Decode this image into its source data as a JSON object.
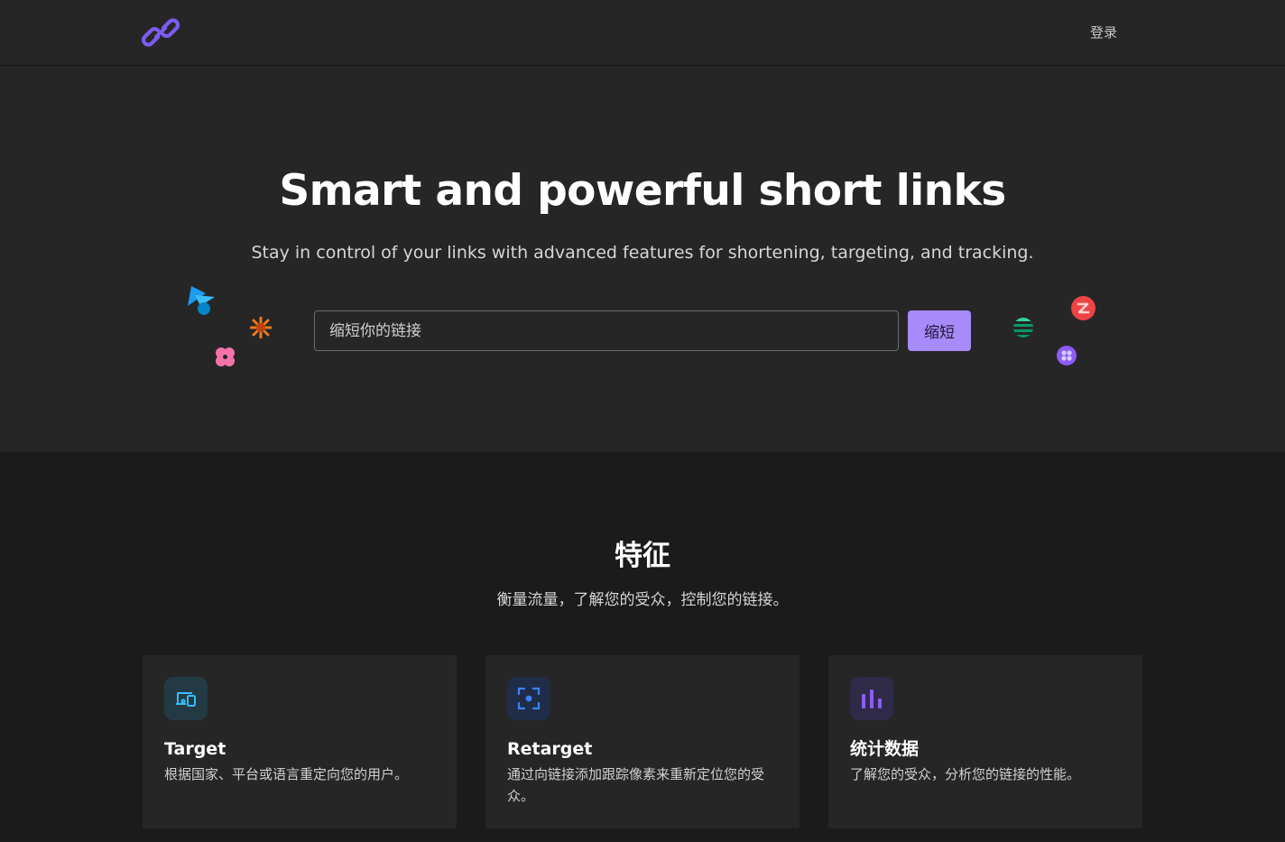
{
  "header": {
    "logo_icon": "link-icon",
    "login_label": "登录"
  },
  "hero": {
    "title": "Smart and powerful short links",
    "subtitle": "Stay in control of your links with advanced features for shortening, targeting, and tracking.",
    "input_placeholder": "缩短你的链接",
    "button_label": "缩短",
    "accent_color": "#a78bfa"
  },
  "features": {
    "title": "特征",
    "subtitle": "衡量流量，了解您的受众，控制您的链接。",
    "cards": [
      {
        "icon": "devices-icon",
        "title": "Target",
        "description": "根据国家、平台或语言重定向您的用户。",
        "icon_color": "#38bdf8"
      },
      {
        "icon": "focus-target-icon",
        "title": "Retarget",
        "description": "通过向链接添加跟踪像素来重新定位您的受众。",
        "icon_color": "#3b82f6"
      },
      {
        "icon": "bar-chart-icon",
        "title": "统计数据",
        "description": "了解您的受众，分析您的链接的性能。",
        "icon_color": "#8b5cf6"
      }
    ]
  }
}
